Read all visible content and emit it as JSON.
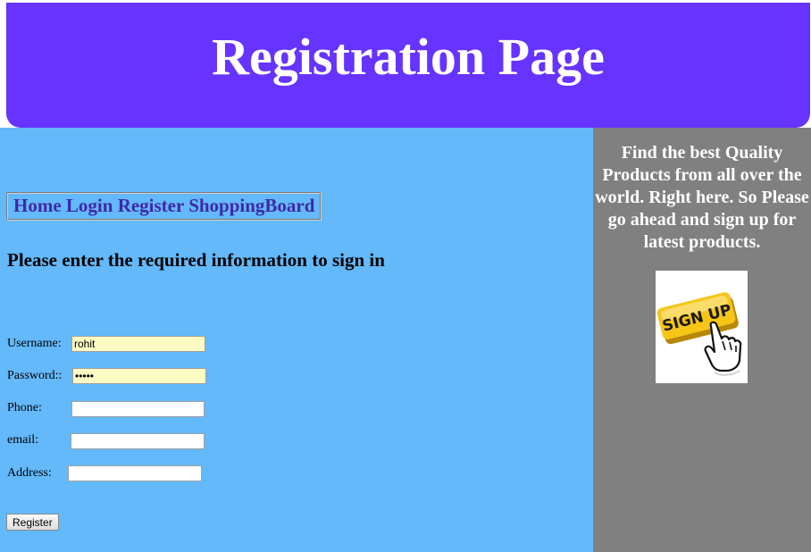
{
  "header": {
    "title": "Registration Page"
  },
  "nav": {
    "items": [
      {
        "label": "Home"
      },
      {
        "label": "Login"
      },
      {
        "label": "Register"
      },
      {
        "label": "ShoppingBoard"
      }
    ]
  },
  "form": {
    "instructions": "Please enter the required information to sign in",
    "username": {
      "label": "Username:",
      "value": "rohit"
    },
    "password": {
      "label": "Password::",
      "value": "hello"
    },
    "phone": {
      "label": "Phone:",
      "value": ""
    },
    "email": {
      "label": "email:",
      "value": ""
    },
    "address": {
      "label": "Address:",
      "value": ""
    },
    "submit_label": "Register"
  },
  "sidebar": {
    "promo": "Find the best Quality Products from all over the world. Right here. So Please go ahead and sign up for latest products.",
    "signup_image": {
      "text": "SIGN UP",
      "icon": "pointing-hand-icon"
    }
  },
  "colors": {
    "header_bg": "#6633ff",
    "main_bg": "#63b9fa",
    "sidebar_bg": "#808080",
    "nav_link": "#4028a8",
    "autofill_bg": "#fbfbc3",
    "signup_yellow": "#f5c518"
  }
}
